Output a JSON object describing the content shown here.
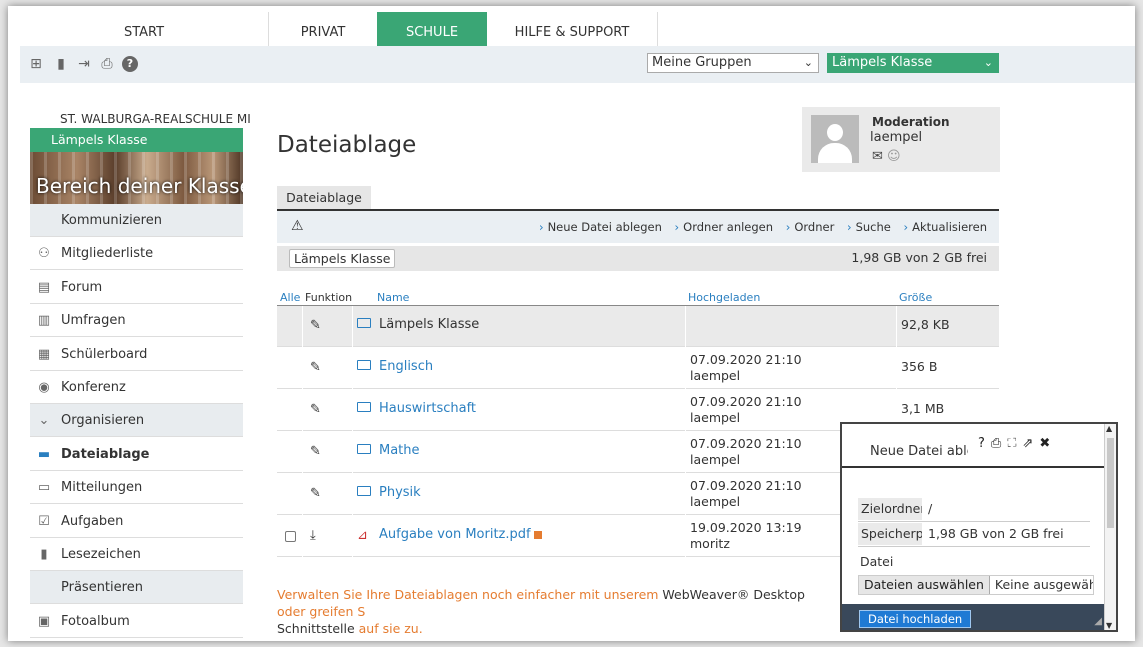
{
  "nav": {
    "tabs": [
      {
        "label": "START"
      },
      {
        "label": "PRIVAT"
      },
      {
        "label": "SCHULE"
      },
      {
        "label": "HILFE & SUPPORT"
      }
    ]
  },
  "toolbar": {
    "icons": [
      "sitemap-icon",
      "bookmark-icon",
      "exit-icon",
      "print-icon",
      "help-icon"
    ],
    "groups_select": "Meine Gruppen",
    "class_select": "Lämpels Klasse"
  },
  "sidebar": {
    "school": "ST. WALBURGA-REALSCHULE MI",
    "class_name": "Lämpels Klasse",
    "banner_text": "Bereich deiner Klasse",
    "items": [
      {
        "label": "Kommunizieren",
        "type": "head",
        "icon": ""
      },
      {
        "label": "Mitgliederliste",
        "type": "item",
        "icon": "members-icon"
      },
      {
        "label": "Forum",
        "type": "item",
        "icon": "forum-icon"
      },
      {
        "label": "Umfragen",
        "type": "item",
        "icon": "chart-icon"
      },
      {
        "label": "Schülerboard",
        "type": "item",
        "icon": "board-icon"
      },
      {
        "label": "Konferenz",
        "type": "item",
        "icon": "conference-icon"
      },
      {
        "label": "Organisieren",
        "type": "head",
        "icon": "chevron-down-icon"
      },
      {
        "label": "Dateiablage",
        "type": "active",
        "icon": "briefcase-icon"
      },
      {
        "label": "Mitteilungen",
        "type": "item",
        "icon": "message-icon"
      },
      {
        "label": "Aufgaben",
        "type": "item",
        "icon": "check-icon"
      },
      {
        "label": "Lesezeichen",
        "type": "item",
        "icon": "bookmark-icon"
      },
      {
        "label": "Präsentieren",
        "type": "head",
        "icon": ""
      },
      {
        "label": "Fotoalbum",
        "type": "item",
        "icon": "photo-icon"
      }
    ]
  },
  "main": {
    "title": "Dateiablage",
    "moderation": {
      "label": "Moderation",
      "user": "laempel"
    },
    "subtab": "Dateiablage",
    "actions": [
      "Neue Datei ablegen",
      "Ordner anlegen",
      "Ordner",
      "Suche",
      "Aktualisieren"
    ],
    "path_button": "Lämpels Klasse",
    "free_space": "1,98 GB von 2 GB frei",
    "columns": {
      "all": "Alle",
      "function": "Funktion",
      "name": "Name",
      "uploaded": "Hochgeladen",
      "size": "Größe"
    },
    "rows": [
      {
        "name": "Lämpels Klasse",
        "date": "",
        "user": "",
        "size": "92,8 KB",
        "kind": "parent"
      },
      {
        "name": "Englisch",
        "date": "07.09.2020 21:10",
        "user": "laempel",
        "size": "356 B",
        "kind": "folder"
      },
      {
        "name": "Hauswirtschaft",
        "date": "07.09.2020 21:10",
        "user": "laempel",
        "size": "3,1 MB",
        "kind": "folder"
      },
      {
        "name": "Mathe",
        "date": "07.09.2020 21:10",
        "user": "laempel",
        "size": "",
        "kind": "folder"
      },
      {
        "name": "Physik",
        "date": "07.09.2020 21:10",
        "user": "laempel",
        "size": "",
        "kind": "folder"
      },
      {
        "name": "Aufgabe von Moritz.pdf",
        "date": "19.09.2020 13:19",
        "user": "moritz",
        "size": "",
        "kind": "file"
      }
    ],
    "footnote": {
      "part1": "Verwalten Sie Ihre Dateiablagen noch einfacher mit unserem ",
      "part2": "WebWeaver® Desktop",
      "part3": " oder greifen S",
      "part4": "Schnittstelle",
      "part5": " auf sie zu."
    }
  },
  "panel": {
    "title": "Neue Datei able",
    "target_label": "Zielordner",
    "target_value": "/",
    "storage_label": "Speicherpl",
    "storage_value": "1,98 GB von 2 GB frei",
    "file_label": "Datei",
    "choose_button": "Dateien auswählen",
    "no_file": "Keine ausgewählt",
    "upload_button": "Datei hochladen"
  }
}
